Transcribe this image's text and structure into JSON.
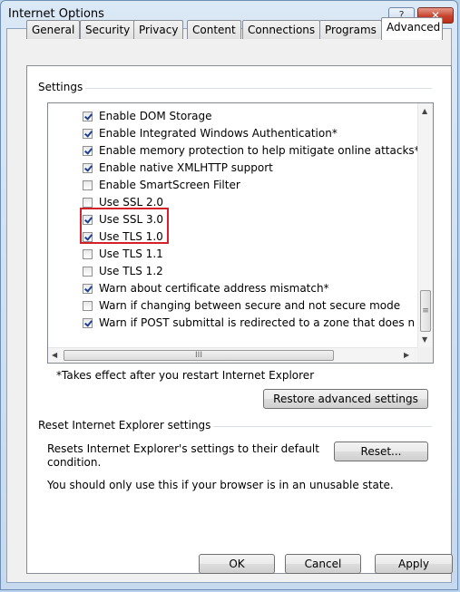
{
  "window": {
    "title": "Internet Options",
    "help_label": "?",
    "close_label": "✕"
  },
  "tabs": [
    {
      "label": "General"
    },
    {
      "label": "Security"
    },
    {
      "label": "Privacy"
    },
    {
      "label": "Content"
    },
    {
      "label": "Connections"
    },
    {
      "label": "Programs"
    },
    {
      "label": "Advanced",
      "active": true
    }
  ],
  "settings": {
    "group_label": "Settings",
    "options": [
      {
        "label": "Enable DOM Storage",
        "checked": true
      },
      {
        "label": "Enable Integrated Windows Authentication*",
        "checked": true
      },
      {
        "label": "Enable memory protection to help mitigate online attacks*",
        "checked": true
      },
      {
        "label": "Enable native XMLHTTP support",
        "checked": true
      },
      {
        "label": "Enable SmartScreen Filter",
        "checked": false
      },
      {
        "label": "Use SSL 2.0",
        "checked": false
      },
      {
        "label": "Use SSL 3.0",
        "checked": true
      },
      {
        "label": "Use TLS 1.0",
        "checked": true
      },
      {
        "label": "Use TLS 1.1",
        "checked": false
      },
      {
        "label": "Use TLS 1.2",
        "checked": false
      },
      {
        "label": "Warn about certificate address mismatch*",
        "checked": true
      },
      {
        "label": "Warn if changing between secure and not secure mode",
        "checked": false
      },
      {
        "label": "Warn if POST submittal is redirected to a zone that does n",
        "checked": true
      }
    ],
    "footnote": "*Takes effect after you restart Internet Explorer",
    "restore_button": "Restore advanced settings",
    "hscroll_grip": "III",
    "vscroll_grip": "≡"
  },
  "reset": {
    "group_label": "Reset Internet Explorer settings",
    "description_line1": "Resets Internet Explorer's settings to their default",
    "description_line2": "condition.",
    "reset_button": "Reset...",
    "note": "You should only use this if your browser is in an unusable state."
  },
  "footer": {
    "ok": "OK",
    "cancel": "Cancel",
    "apply": "Apply"
  },
  "colors": {
    "highlight_border": "#d4202a",
    "checkmark": "#1c3f94"
  }
}
